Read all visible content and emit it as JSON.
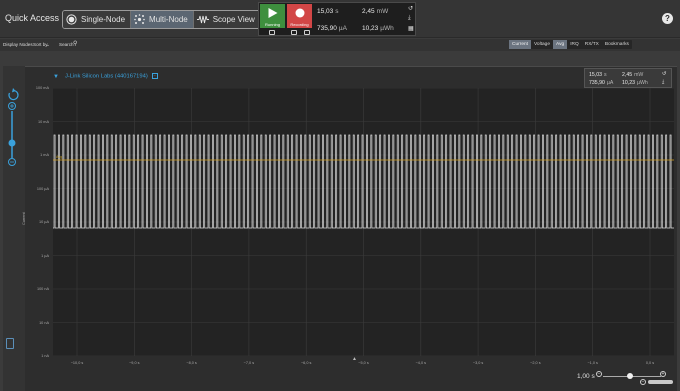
{
  "toolbar": {
    "quick_access": "Quick Access",
    "modes": [
      {
        "label": "Single-Node",
        "icon": "single-node-icon",
        "active": false
      },
      {
        "label": "Multi-Node",
        "icon": "multi-node-icon",
        "active": true
      },
      {
        "label": "Scope View",
        "icon": "scope-view-icon",
        "active": false
      }
    ],
    "run_label": "Running",
    "rec_label": "Recording",
    "stats": {
      "time": "15,03",
      "time_unit": "s",
      "power": "2,45",
      "power_unit": "mW",
      "current": "735,90",
      "current_unit": "µA",
      "energy": "10,23",
      "energy_unit": "µWh"
    },
    "help": "?"
  },
  "subbar": {
    "display_nodes": "Display Nodes",
    "sort_by": "Sort by",
    "search": "Search",
    "segments": [
      {
        "label": "Current",
        "selected": true
      },
      {
        "label": "Voltage",
        "selected": false
      },
      {
        "label": "Avg",
        "selected": true
      },
      {
        "label": "IRQ",
        "selected": false
      },
      {
        "label": "RX/TX",
        "selected": false
      },
      {
        "label": "Bookmarks",
        "selected": false
      }
    ]
  },
  "graph": {
    "device_name": "J-Link Silicon Labs (440167194)",
    "stats": {
      "time": "15,03",
      "time_unit": "s",
      "power": "2,45",
      "power_unit": "mW",
      "current": "735,90",
      "current_unit": "µA",
      "energy": "10,23",
      "energy_unit": "µWh"
    },
    "y_axis_label": "Current",
    "y_ticks": [
      "100 mA",
      "10 mA",
      "1 mA",
      "100 µA",
      "10 µA",
      "1 µA",
      "100 nA",
      "10 nA",
      "1 nA"
    ],
    "x_ticks": [
      "−10,0 s",
      "−9,0 s",
      "−8,0 s",
      "−7,0 s",
      "−6,0 s",
      "−5,0 s",
      "−4,0 s",
      "−3,0 s",
      "−2,0 s",
      "−1,0 s",
      "0,0 s"
    ],
    "marker_label": "Avg",
    "zoom_value": "1,00 s",
    "colors": {
      "plot_bg": "#232323",
      "signal": "#dcdcdc",
      "average": "#d4a020",
      "accent": "#3aa1dc"
    }
  }
}
